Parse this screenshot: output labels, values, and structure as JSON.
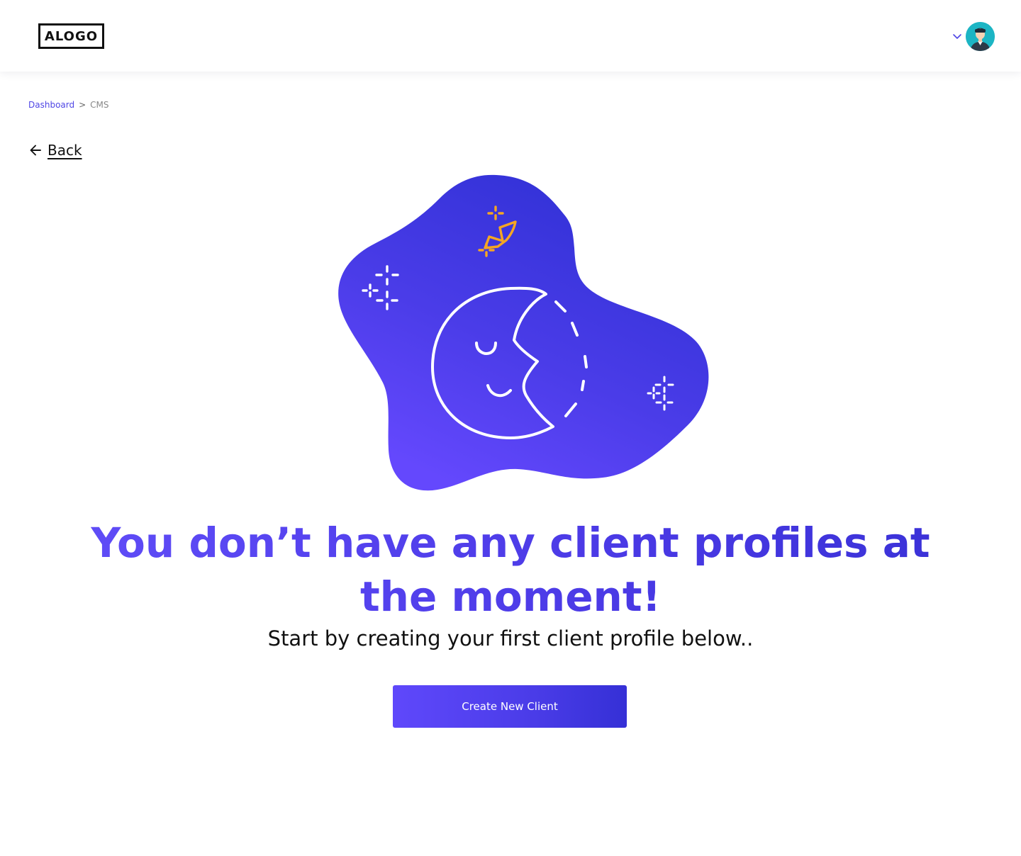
{
  "header": {
    "logo_text": "ALOGO",
    "user_menu_icon": "chevron-down-icon",
    "avatar_icon": "user-avatar"
  },
  "breadcrumb": {
    "items": [
      "Dashboard",
      "CMS"
    ],
    "separator": ">"
  },
  "back": {
    "label": "Back",
    "icon": "arrow-left-icon"
  },
  "empty_state": {
    "illustration": "sleeping-moon-illustration",
    "headline_line1": "You don’t have any client profiles at",
    "headline_line2": "the moment!",
    "subheadline": "Start by creating your first client profile below..",
    "cta_label": "Create New Client"
  },
  "colors": {
    "accent": "#5b47f3",
    "accent_dark": "#3530d6",
    "star_yellow": "#f5a623",
    "avatar_bg": "#1cb5c4",
    "text": "#111111"
  }
}
